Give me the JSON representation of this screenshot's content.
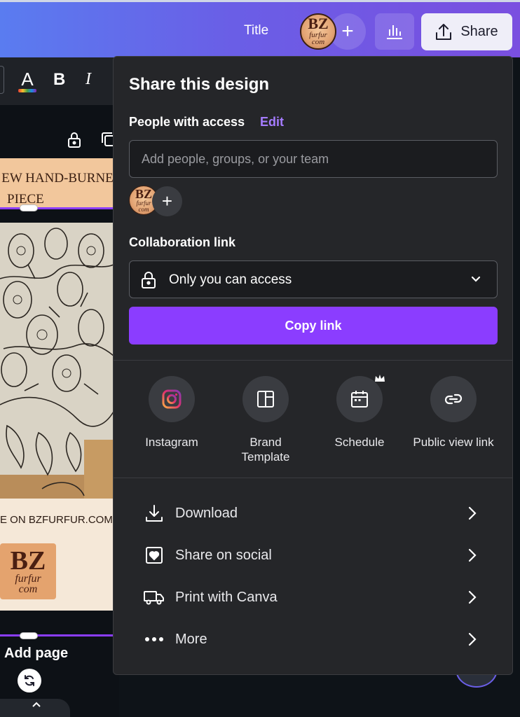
{
  "header": {
    "title": "Title",
    "avatar_logo": {
      "line1": "BZ",
      "line2": "furfur",
      "line3": "com"
    },
    "add_button_symbol": "+",
    "share_label": "Share"
  },
  "toolbar": {
    "text_color_glyph": "A",
    "bold_glyph": "B",
    "italic_glyph": "I"
  },
  "canvas": {
    "headline_line1": "EW HAND-BURNE",
    "headline_line2": "PIECE",
    "footer_url": "E ON BZFURFUR.COM",
    "logo": {
      "line1": "BZ",
      "line2": "furfur",
      "line3": "com"
    },
    "add_page_label": "Add page"
  },
  "share_panel": {
    "title": "Share this design",
    "people_label": "People with access",
    "edit_label": "Edit",
    "add_people_placeholder": "Add people, groups, or your team",
    "collab_label": "Collaboration link",
    "access_value": "Only you can access",
    "copy_link_label": "Copy link",
    "options": [
      {
        "label": "Instagram",
        "icon": "instagram-icon"
      },
      {
        "label": "Brand Template",
        "icon": "brand-template-icon"
      },
      {
        "label": "Schedule",
        "icon": "calendar-icon"
      },
      {
        "label": "Public view link",
        "icon": "link-icon"
      }
    ],
    "actions": [
      {
        "label": "Download",
        "icon": "download-icon"
      },
      {
        "label": "Share on social",
        "icon": "heart-icon"
      },
      {
        "label": "Print with Canva",
        "icon": "truck-icon"
      },
      {
        "label": "More",
        "icon": "more-icon"
      }
    ]
  },
  "colors": {
    "accent": "#8b3dff",
    "edit_link": "#a57cff",
    "panel_bg": "#252629",
    "header_gradient_start": "#5a7cf0",
    "header_gradient_end": "#7a4fe0"
  }
}
